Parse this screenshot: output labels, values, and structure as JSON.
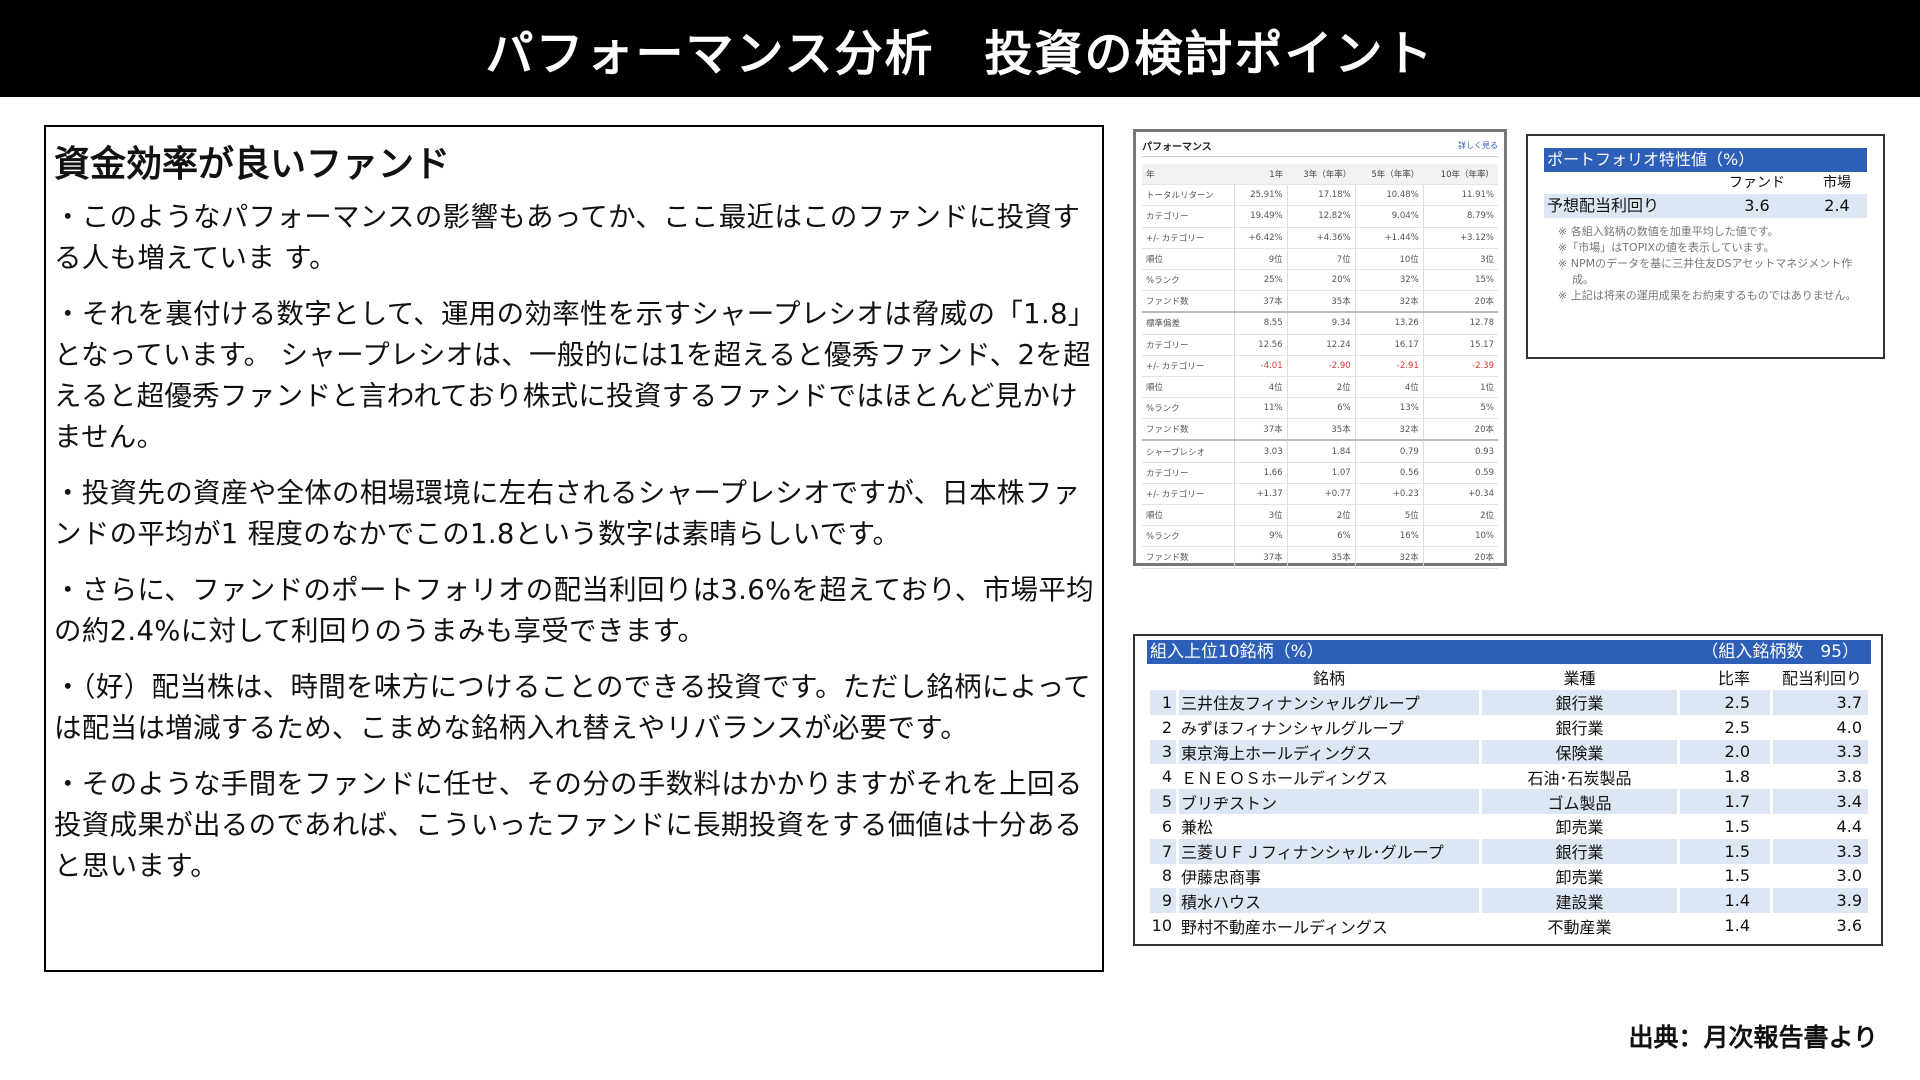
{
  "title": "パフォーマンス分析　投資の検討ポイント",
  "main": {
    "heading": "資金効率が良いファンド",
    "paragraphs": [
      "・このようなパフォーマンスの影響もあってか、ここ最近はこのファンドに投資する人も増えていま す。",
      "・それを裏付ける数字として、運用の効率性を示すシャープレシオは脅威の「1.8」となっています。 シャープレシオは、一般的には1を超えると優秀ファンド、2を超えると超優秀ファンドと言われており株式に投資するファンドではほとんど見かけません。",
      "・投資先の資産や全体の相場環境に左右されるシャープレシオですが、日本株ファンドの平均が1 程度のなかでこの1.8という数字は素晴らしいです。",
      "・さらに、ファンドのポートフォリオの配当利回りは3.6%を超えており、市場平均の約2.4%に対して利回りのうまみも享受できます。",
      "・（好）配当株は、時間を味方につけることのできる投資です。ただし銘柄によっては配当は増減するため、こまめな銘柄入れ替えやリバランスが必要です。",
      "・そのような手間をファンドに任せ、その分の手数料はかかりますがそれを上回る投資成果が出るのであれば、こういったファンドに長期投資をする価値は十分あると思います。"
    ]
  },
  "performance": {
    "title": "パフォーマンス",
    "link": "詳しく見る",
    "columns": [
      "年",
      "1年",
      "3年（年率）",
      "5年（年率）",
      "10年（年率）"
    ],
    "rows": [
      [
        "トータルリターン",
        "25.91%",
        "17.18%",
        "10.48%",
        "11.91%"
      ],
      [
        "カテゴリー",
        "19.49%",
        "12.82%",
        "9.04%",
        "8.79%"
      ],
      [
        "+/- カテゴリー",
        "+6.42%",
        "+4.36%",
        "+1.44%",
        "+3.12%"
      ],
      [
        "順位",
        "9位",
        "7位",
        "10位",
        "3位"
      ],
      [
        "%ランク",
        "25%",
        "20%",
        "32%",
        "15%"
      ],
      [
        "ファンド数",
        "37本",
        "35本",
        "32本",
        "20本"
      ],
      [
        "標準偏差",
        "8.55",
        "9.34",
        "13.26",
        "12.78"
      ],
      [
        "カテゴリー",
        "12.56",
        "12.24",
        "16.17",
        "15.17"
      ],
      [
        "+/- カテゴリー",
        "-4.01",
        "-2.90",
        "-2.91",
        "-2.39"
      ],
      [
        "順位",
        "4位",
        "2位",
        "4位",
        "1位"
      ],
      [
        "%ランク",
        "11%",
        "6%",
        "13%",
        "5%"
      ],
      [
        "ファンド数",
        "37本",
        "35本",
        "32本",
        "20本"
      ],
      [
        "シャープレシオ",
        "3.03",
        "1.84",
        "0.79",
        "0.93"
      ],
      [
        "カテゴリー",
        "1.66",
        "1.07",
        "0.56",
        "0.59"
      ],
      [
        "+/- カテゴリー",
        "+1.37",
        "+0.77",
        "+0.23",
        "+0.34"
      ],
      [
        "順位",
        "3位",
        "2位",
        "5位",
        "2位"
      ],
      [
        "%ランク",
        "9%",
        "6%",
        "16%",
        "10%"
      ],
      [
        "ファンド数",
        "37本",
        "35本",
        "32本",
        "20本"
      ]
    ]
  },
  "portfolio": {
    "title": "ポートフォリオ特性値（%）",
    "col_fund": "ファンド",
    "col_market": "市場",
    "row_label": "予想配当利回り",
    "fund_value": "3.6",
    "market_value": "2.4",
    "notes": [
      "※ 各組入銘柄の数値を加重平均した値です。",
      "※「市場」はTOPIXの値を表示しています。",
      "※ NPMのデータを基に三井住友DSアセットマネジメント作成。",
      "※ 上記は将来の運用成果をお約束するものではありません。"
    ]
  },
  "holdings": {
    "title": "組入上位10銘柄（%）",
    "count": "（組入銘柄数　95）",
    "columns": [
      "銘柄",
      "業種",
      "比率",
      "配当利回り"
    ],
    "rows": [
      [
        "1",
        "三井住友フィナンシャルグループ",
        "銀行業",
        "2.5",
        "3.7"
      ],
      [
        "2",
        "みずほフィナンシャルグループ",
        "銀行業",
        "2.5",
        "4.0"
      ],
      [
        "3",
        "東京海上ホールディングス",
        "保険業",
        "2.0",
        "3.3"
      ],
      [
        "4",
        "ＥＮＥＯＳホールディングス",
        "石油･石炭製品",
        "1.8",
        "3.8"
      ],
      [
        "5",
        "ブリヂストン",
        "ゴム製品",
        "1.7",
        "3.4"
      ],
      [
        "6",
        "兼松",
        "卸売業",
        "1.5",
        "4.4"
      ],
      [
        "7",
        "三菱ＵＦＪフィナンシャル･グループ",
        "銀行業",
        "1.5",
        "3.3"
      ],
      [
        "8",
        "伊藤忠商事",
        "卸売業",
        "1.5",
        "3.0"
      ],
      [
        "9",
        "積水ハウス",
        "建設業",
        "1.4",
        "3.9"
      ],
      [
        "10",
        "野村不動産ホールディングス",
        "不動産業",
        "1.4",
        "3.6"
      ]
    ]
  },
  "source": "出典：月次報告書より"
}
